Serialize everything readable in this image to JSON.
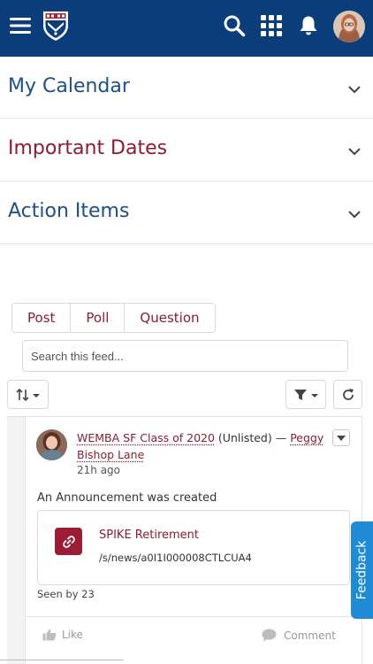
{
  "header": {
    "background": "#0b3d7a",
    "icons": [
      "menu-icon",
      "penn-shield-logo",
      "search-icon",
      "apps-grid-icon",
      "bell-icon",
      "user-avatar"
    ]
  },
  "sections": [
    {
      "title": "My Calendar",
      "color": "#1d4f8a"
    },
    {
      "title": "Important Dates",
      "color": "#8b1d32"
    },
    {
      "title": "Action Items",
      "color": "#1d4f8a"
    }
  ],
  "publisher": {
    "tabs": [
      "Post",
      "Poll",
      "Question"
    ]
  },
  "feed": {
    "search_placeholder": "Search this feed...",
    "post": {
      "group": "WEMBA SF Class of 2020",
      "group_status": "(Unlisted) —",
      "author": "Peggy Bishop Lane",
      "time": "21h ago",
      "body": "An Announcement was created",
      "link": {
        "title": "SPIKE Retirement",
        "url": "/s/news/a0I1I000008CTLCUA4"
      },
      "seen_by": "Seen by 23",
      "like_label": "Like",
      "comment_label": "Comment"
    }
  },
  "feedback": {
    "label": "Feedback",
    "color": "#1f8ad6"
  }
}
